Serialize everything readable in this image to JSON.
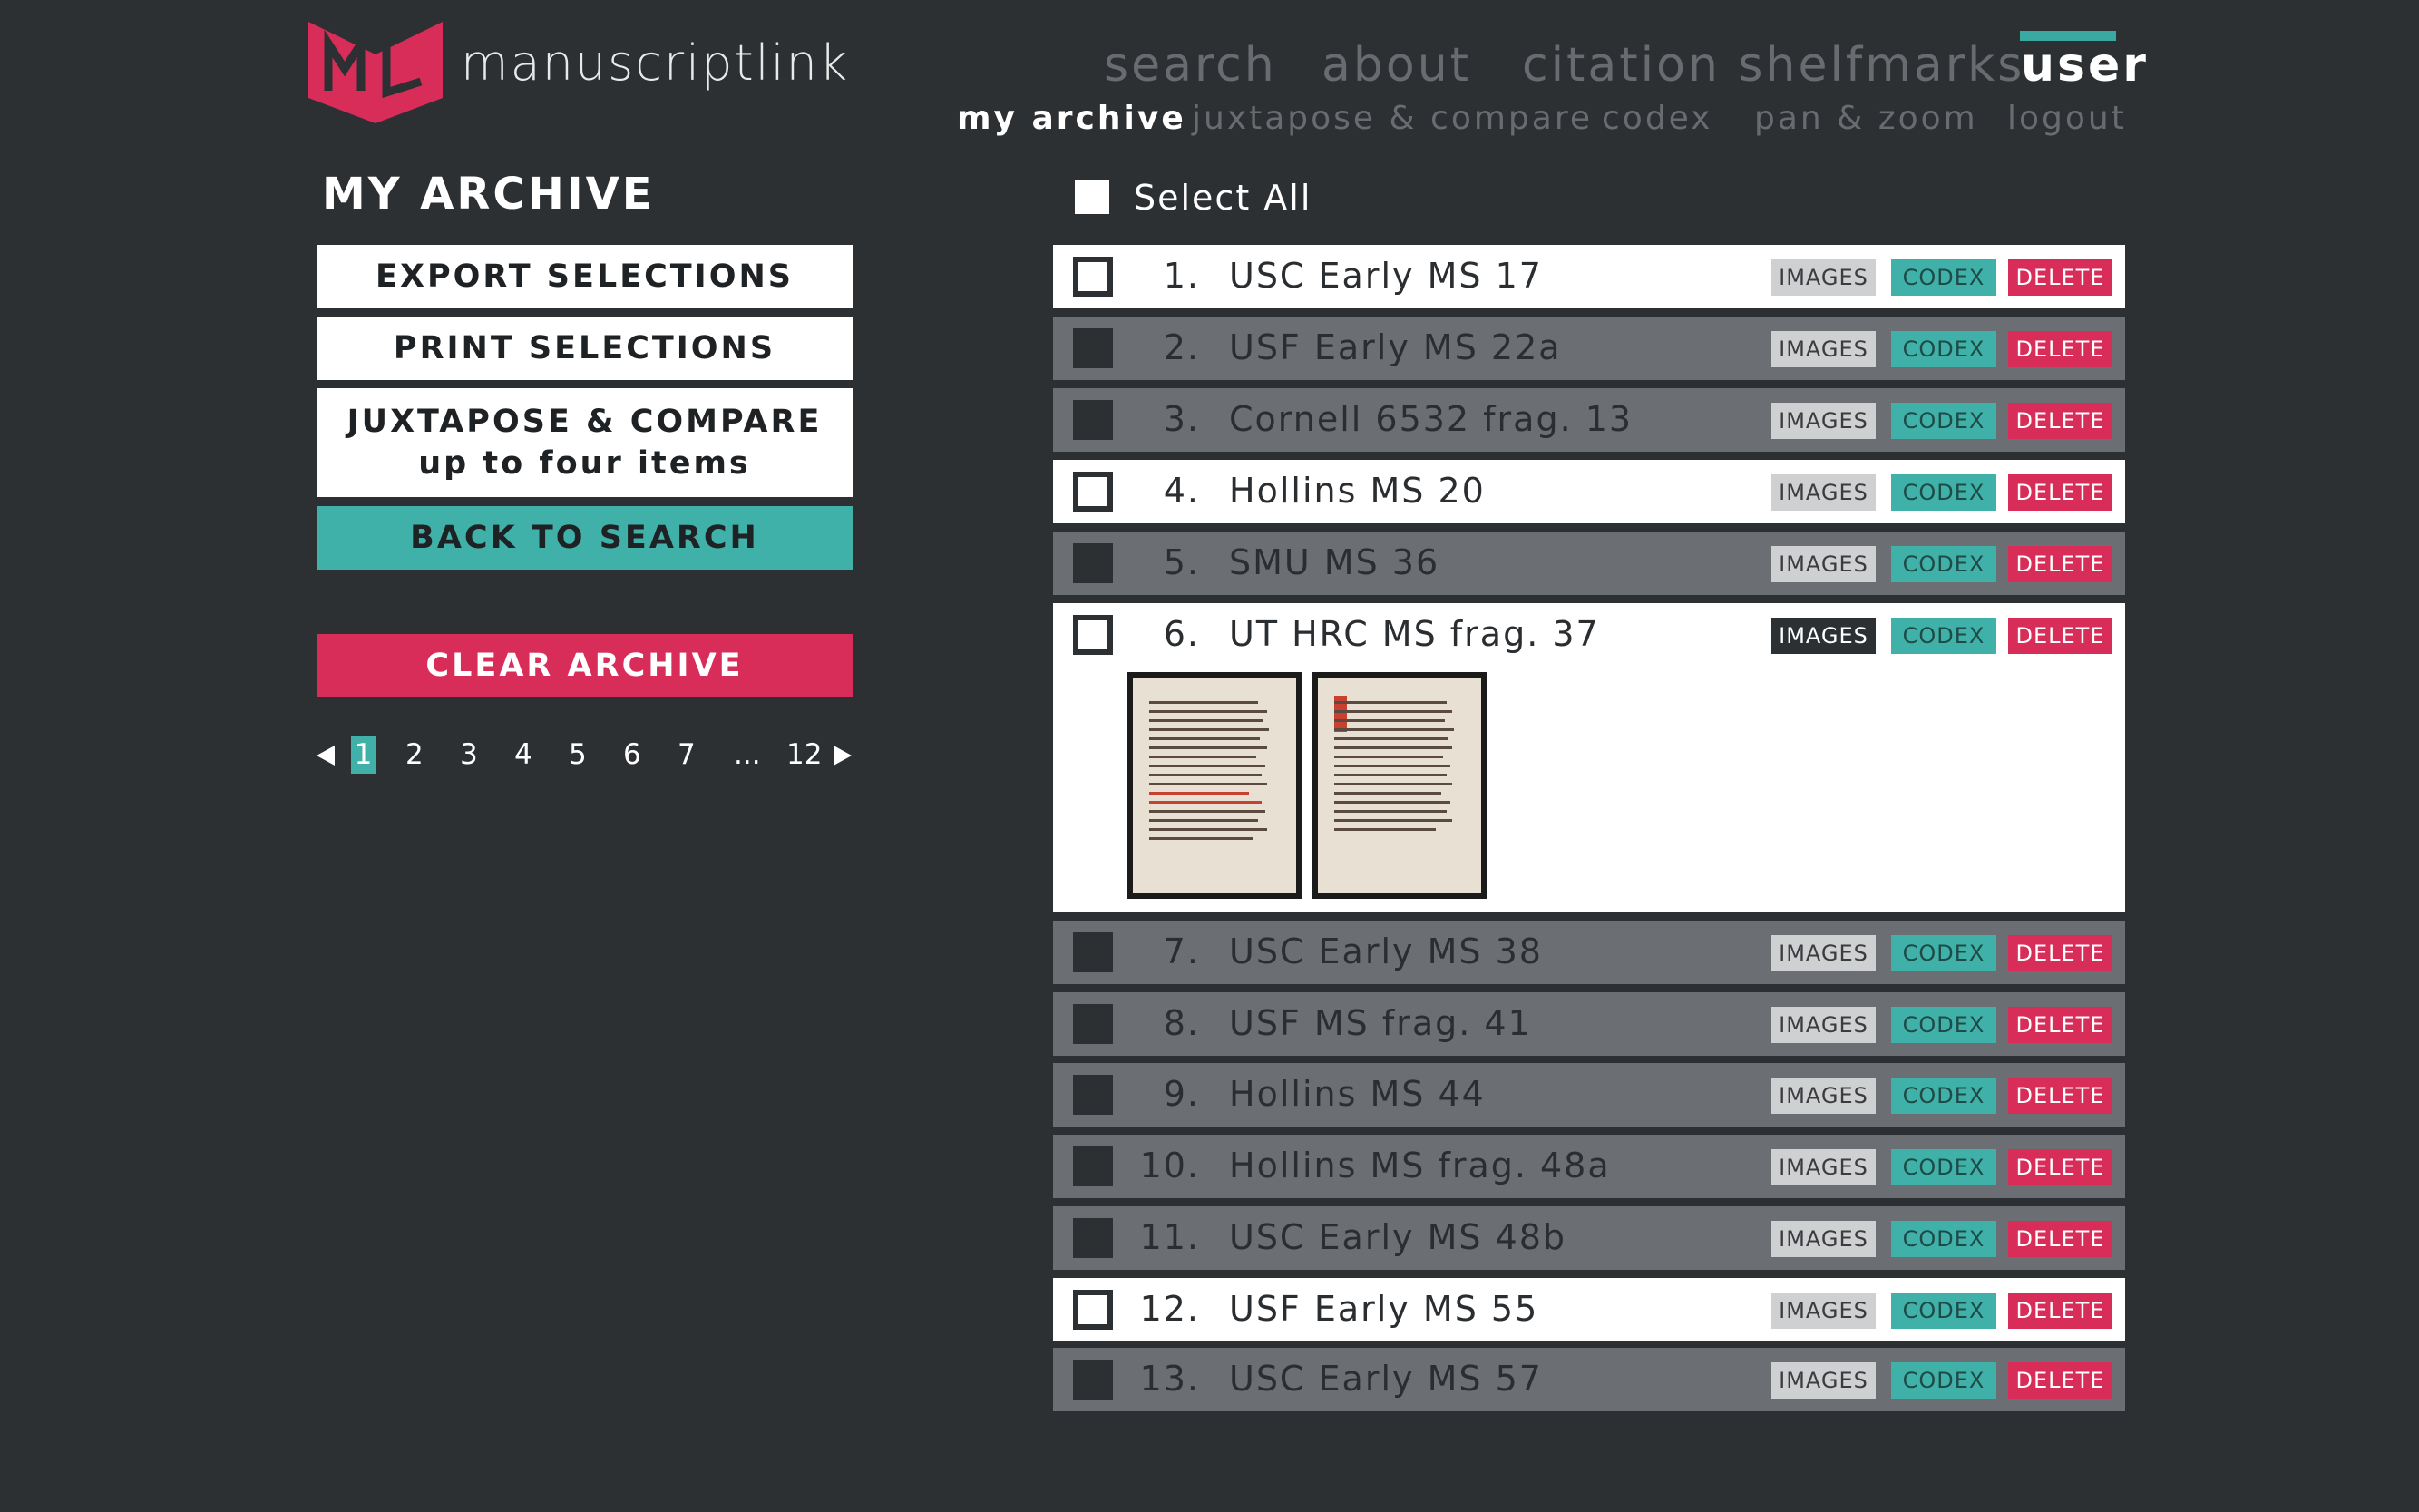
{
  "brand": {
    "name": "manuscriptlink",
    "logo_letters": "ML"
  },
  "colors": {
    "accent_teal": "#40b1a8",
    "accent_red": "#d72d58",
    "background": "#2d3033",
    "row_grey": "#6b6e72"
  },
  "nav": {
    "top": [
      {
        "label": "search",
        "active": false
      },
      {
        "label": "about",
        "active": false
      },
      {
        "label": "citation shelfmarks",
        "active": false
      },
      {
        "label": "user",
        "active": true
      }
    ],
    "sub": [
      {
        "label": "my archive",
        "active": true
      },
      {
        "label": "juxtapose & compare",
        "active": false
      },
      {
        "label": "codex",
        "active": false
      },
      {
        "label": "pan & zoom",
        "active": false
      },
      {
        "label": "logout",
        "active": false
      }
    ]
  },
  "sidebar": {
    "title": "MY ARCHIVE",
    "export_label": "EXPORT SELECTIONS",
    "print_label": "PRINT SELECTIONS",
    "juxtapose_label": "JUXTAPOSE & COMPARE",
    "juxtapose_sub": "up to four items",
    "back_label": "BACK TO SEARCH",
    "clear_label": "CLEAR ARCHIVE",
    "pagination": {
      "current": "1",
      "pages": [
        "1",
        "2",
        "3",
        "4",
        "5",
        "6",
        "7",
        "...",
        "12"
      ]
    }
  },
  "list": {
    "select_all_label": "Select All",
    "button_labels": {
      "images": "IMAGES",
      "codex": "CODEX",
      "delete": "DELETE"
    },
    "items": [
      {
        "num": "1.",
        "title": "USC Early MS 17",
        "selected": true
      },
      {
        "num": "2.",
        "title": "USF Early MS 22a",
        "selected": false
      },
      {
        "num": "3.",
        "title": "Cornell 6532 frag. 13",
        "selected": false
      },
      {
        "num": "4.",
        "title": "Hollins MS 20",
        "selected": true
      },
      {
        "num": "5.",
        "title": "SMU MS 36",
        "selected": false
      },
      {
        "num": "6.",
        "title": "UT HRC MS frag. 37",
        "selected": true,
        "expanded": true
      },
      {
        "num": "7.",
        "title": "USC Early MS 38",
        "selected": false
      },
      {
        "num": "8.",
        "title": "USF MS frag. 41",
        "selected": false
      },
      {
        "num": "9.",
        "title": "Hollins MS 44",
        "selected": false
      },
      {
        "num": "10.",
        "title": "Hollins MS frag. 48a",
        "selected": false
      },
      {
        "num": "11.",
        "title": "USC Early MS 48b",
        "selected": false
      },
      {
        "num": "12.",
        "title": "USF Early MS 55",
        "selected": true
      },
      {
        "num": "13.",
        "title": "USC Early MS 57",
        "selected": false
      }
    ]
  }
}
